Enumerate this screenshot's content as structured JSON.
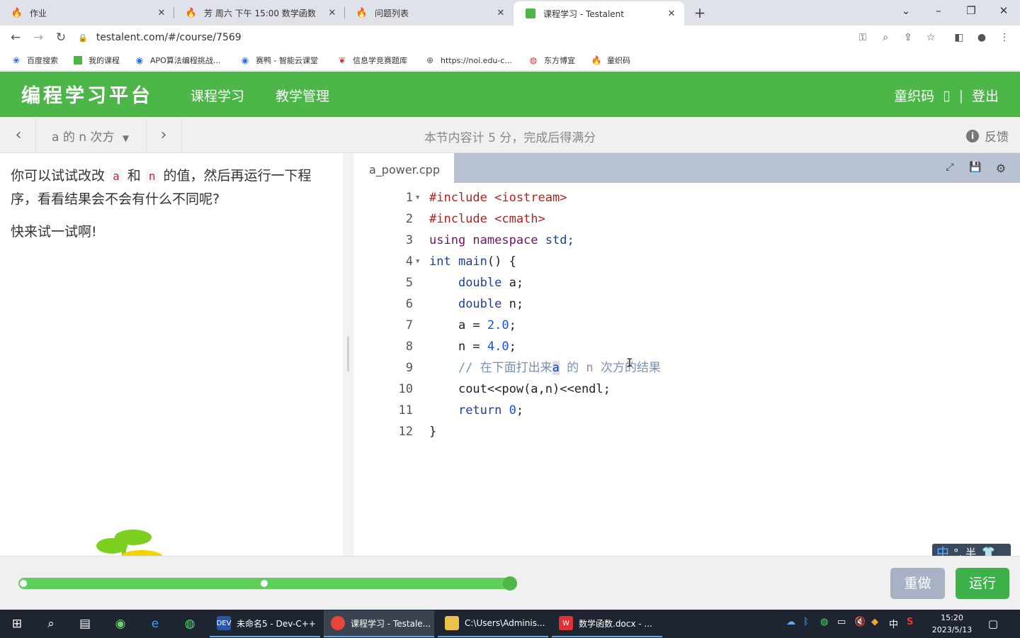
{
  "browser": {
    "tabs": [
      {
        "title": "作业",
        "icon": "flame-icon"
      },
      {
        "title": "芳 周六 下午 15:00 数学函数",
        "icon": "flame-icon"
      },
      {
        "title": "问题列表",
        "icon": "flame-icon"
      },
      {
        "title": "课程学习 - Testalent",
        "icon": "green-square-icon",
        "active": true
      }
    ],
    "url": "testalent.com/#/course/7569",
    "bookmarks": [
      {
        "label": "百度搜索"
      },
      {
        "label": "我的课程"
      },
      {
        "label": "APO算法编程挑战..."
      },
      {
        "label": "赛鸭 - 智能云课堂"
      },
      {
        "label": "信息学竞赛题库"
      },
      {
        "label": "https://noi.edu-c..."
      },
      {
        "label": "东方博宜"
      },
      {
        "label": "童织码"
      }
    ]
  },
  "app": {
    "brand": "编程学习平台",
    "nav": [
      "课程学习",
      "教学管理"
    ],
    "user_name": "童织码",
    "user_box": "▯",
    "divider": "|",
    "logout": "登出",
    "accent_color": "#4cb648"
  },
  "subbar": {
    "lesson": "a 的 n 次方",
    "score_note": "本节内容计 5 分，完成后得满分",
    "feedback": "反馈"
  },
  "instructions": {
    "p1_before": "你可以试试改改",
    "var_a": "a",
    "and": "和",
    "var_n": "n",
    "p1_after": "的值，然后再运行一下程序，看看结果会不会有什么不同呢?",
    "p2": "快来试一试啊!"
  },
  "editor": {
    "filename": "a_power.cpp",
    "line_numbers": [
      "1",
      "2",
      "3",
      "4",
      "5",
      "6",
      "7",
      "8",
      "9",
      "10",
      "11",
      "12"
    ],
    "l1": "#include <iostream>",
    "l2": "#include <cmath>",
    "l3_kw": "using namespace",
    "l3_rest": " std;",
    "l4_kw": "int",
    "l4_fn": " main",
    "l4_rest": "() {",
    "l5_kw": "double",
    "l5_rest": " a;",
    "l6_kw": "double",
    "l6_rest": " n;",
    "l7_lhs": "a = ",
    "l7_num": "2.0",
    "l7_end": ";",
    "l8_lhs": "n = ",
    "l8_num": "4.0",
    "l8_end": ";",
    "l9_c1": "// 在下面打出来",
    "l9_hl": "a",
    "l9_c2": " 的 n 次方的结果",
    "l10": "cout<<pow(a,n)<<endl;",
    "l11_kw": "return",
    "l11_num": "0",
    "l11_end": ";",
    "l12": "}"
  },
  "ime": {
    "zh": "中",
    "rest": "°, 半"
  },
  "controls": {
    "progress_percent": 100,
    "redo": "重做",
    "run": "运行"
  },
  "taskbar": {
    "apps": [
      {
        "label": "未命名5 - Dev-C++"
      },
      {
        "label": "课程学习 - Testale..."
      },
      {
        "label": "C:\\Users\\Adminis..."
      },
      {
        "label": "数学函数.docx - ..."
      }
    ],
    "tray_lang": "中",
    "time": "15:20",
    "date": "2023/5/13"
  }
}
